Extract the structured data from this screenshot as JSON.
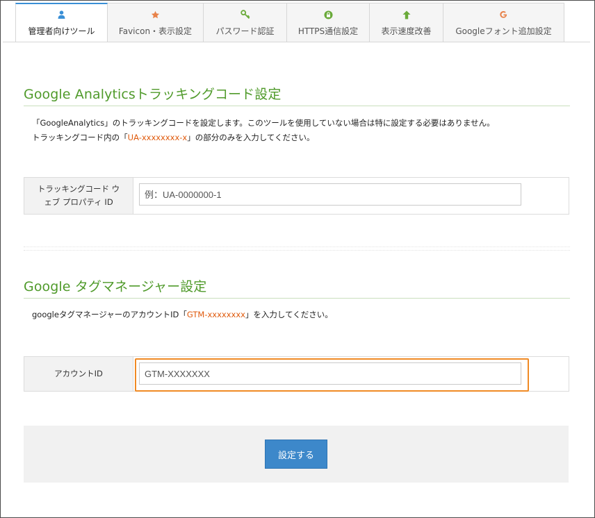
{
  "tabs": [
    {
      "label": "管理者向けツール",
      "icon": "user-icon",
      "color": "#3a8fd6",
      "active": true
    },
    {
      "label": "Favicon・表示設定",
      "icon": "star-icon",
      "color": "#e8824a",
      "active": false
    },
    {
      "label": "パスワード認証",
      "icon": "key-icon",
      "color": "#6aaa3a",
      "active": false
    },
    {
      "label": "HTTPS通信設定",
      "icon": "lock-icon",
      "color": "#6aaa3a",
      "active": false
    },
    {
      "label": "表示速度改善",
      "icon": "arrow-up-icon",
      "color": "#6aaa3a",
      "active": false
    },
    {
      "label": "Googleフォント追加設定",
      "icon": "google-icon",
      "color": "#e8824a",
      "active": false
    }
  ],
  "analytics": {
    "title": "Google Analyticsトラッキングコード設定",
    "desc_line1": "「GoogleAnalytics」のトラッキングコードを設定します。このツールを使用していない場合は特に設定する必要はありません。",
    "desc_line2_prefix": "トラッキングコード内の「",
    "desc_line2_code": "UA-xxxxxxxx-x",
    "desc_line2_suffix": "」の部分のみを入力してください。",
    "field_label_line1": "トラッキングコード ウ",
    "field_label_line2": "ェブ プロパティ ID",
    "field_placeholder": "例：UA-0000000-1"
  },
  "gtm": {
    "title": "Google タグマネージャー設定",
    "desc_prefix": "googleタグマネージャーのアカウントID「",
    "desc_code": "GTM-xxxxxxxx",
    "desc_suffix": "」を入力してください。",
    "field_label": "アカウントID",
    "field_placeholder": "GTM-XXXXXXX"
  },
  "submit_label": "設定する",
  "colors": {
    "accent_green": "#4f9a2a",
    "highlight_orange": "#f08a24",
    "button_blue": "#3d88ca",
    "code_orange": "#e05a0c"
  }
}
